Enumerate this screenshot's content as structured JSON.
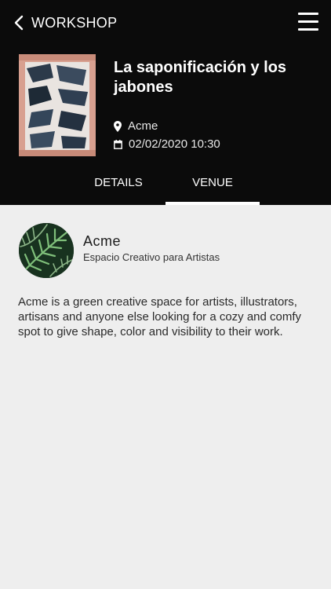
{
  "header": {
    "back_label": "WORKSHOP",
    "back_icon": "chevron-left-icon",
    "menu_icon": "hamburger-menu-icon"
  },
  "event": {
    "title": "La saponificación y los jabones",
    "location": "Acme",
    "datetime": "02/02/2020 10:30",
    "location_icon": "map-pin-icon",
    "date_icon": "calendar-icon"
  },
  "tabs": [
    {
      "label": "DETAILS",
      "active": false
    },
    {
      "label": "VENUE",
      "active": true
    }
  ],
  "venue": {
    "name": "Acme",
    "subtitle": "Espacio Creativo para Artistas",
    "description": "Acme is a green creative space for artists, illustrators, artisans and anyone else looking for a cozy and comfy spot to give shape, color and visibility to their work."
  },
  "colors": {
    "header_bg": "#0b0b0b",
    "page_bg": "#eeeeee",
    "accent": "#ffffff"
  }
}
